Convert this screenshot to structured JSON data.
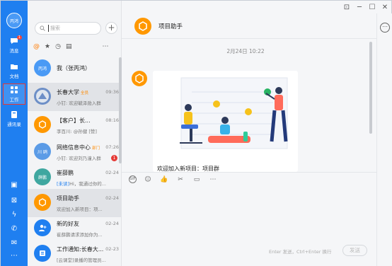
{
  "window": {
    "controls": [
      "□",
      "─",
      "☐",
      "✕"
    ]
  },
  "nav": {
    "avatar_label": "丙鸿",
    "items": [
      {
        "label": "消息",
        "icon": "chat-bubble-icon",
        "badge": "1"
      },
      {
        "label": "文档",
        "icon": "folder-icon"
      },
      {
        "label": "工作",
        "icon": "grid-apps-icon"
      },
      {
        "label": "通讯录",
        "icon": "contacts-icon"
      }
    ],
    "tools": [
      "calendar-icon",
      "pin-icon",
      "lightning-icon",
      "phone-icon",
      "mail-icon",
      "more-dots-icon"
    ]
  },
  "list": {
    "search_placeholder": "搜索",
    "plus": "+",
    "conversations": [
      {
        "title": "我（张丙鸿）",
        "tag": "",
        "time": "",
        "preview": "",
        "badge": "",
        "avatar_text": "丙鸿",
        "avatar_color": "#4a9af5"
      },
      {
        "title": "长春大学",
        "tag": "全员",
        "time": "09:36",
        "preview": "小钉: 欢迎毓泽勋入群",
        "badge": "",
        "avatar_text": "",
        "avatar_color": "#6d8fc7"
      },
      {
        "title": "【客户】长...",
        "tag": "",
        "time": "08:16",
        "preview": "李百川: @孙健 [赞]",
        "badge": "",
        "avatar_text": "",
        "avatar_color": "#ff9800"
      },
      {
        "title": "网络信息中心",
        "tag": "部门",
        "time": "07:26",
        "preview": "小钉: 欢迎刘乃潼入群",
        "badge": "1",
        "avatar_text": "川 鸥",
        "avatar_color": "#5b9be6"
      },
      {
        "title": "崔薛鹏",
        "tag": "",
        "time": "02-24",
        "preview_hl": "[未读]",
        "preview": "Hi，我通过你的...",
        "badge": "",
        "avatar_text": "薛鹏",
        "avatar_color": "#3fa7a0"
      },
      {
        "title": "项目助手",
        "tag": "",
        "time": "02-24",
        "preview": "欢迎加入新项目：项...",
        "badge": "",
        "avatar_text": "",
        "avatar_color": "#ff9800"
      },
      {
        "title": "新的好友",
        "tag": "",
        "time": "02-24",
        "preview": "崔薛鹏请求添加你为...",
        "badge": "",
        "avatar_text": "",
        "avatar_color": "#1f7ff0"
      },
      {
        "title": "工作通知:长春大...",
        "tag": "",
        "time": "02-23",
        "preview": "[云课堂]录播的管理员...",
        "badge": "",
        "avatar_text": "",
        "avatar_color": "#1f7ff0"
      }
    ]
  },
  "chat": {
    "title": "项目助手",
    "date_separator": "2月24日 10:22",
    "card_text": "欢迎加入新项目：项目群",
    "toolbar": [
      "GIF",
      "☺",
      "👍",
      "✂",
      "▭",
      "⋯"
    ],
    "input_hint": "Enter 发送，Ctrl+Enter 换行",
    "send_label": "发送"
  },
  "colors": {
    "brand": "#1f7ff0",
    "accent": "#ff9800",
    "alert": "#e53935"
  }
}
